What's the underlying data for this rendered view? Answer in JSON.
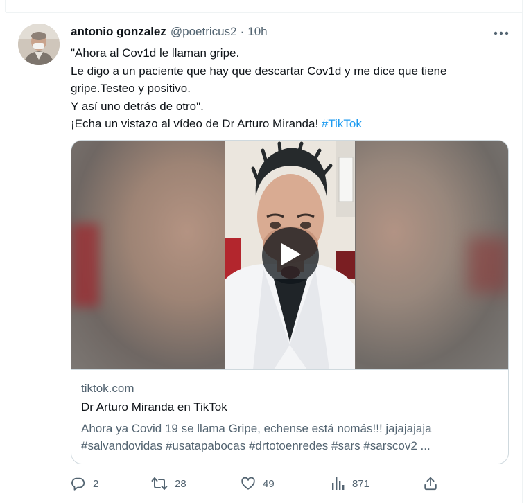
{
  "tweet": {
    "author_name": "antonio gonzalez",
    "author_handle": "@poetricus2",
    "separator": "·",
    "time_ago": "10h",
    "text_lines": [
      "\"Ahora al Cov1d le llaman gripe.",
      "Le digo a un paciente que hay que descartar Cov1d y me dice que tiene",
      "gripe.Testeo y positivo.",
      "Y así uno detrás de otro\".",
      "¡Echa un vistazo al vídeo de Dr Arturo Miranda! "
    ],
    "hashtag": "#TikTok"
  },
  "link_card": {
    "domain": "tiktok.com",
    "title": "Dr Arturo Miranda en TikTok",
    "description_lines": [
      "Ahora ya Covid 19 se llama Gripe, echense está nomás!!! jajajajaja",
      "#salvandovidas #usatapabocas #drtotoenredes #sars #sarscov2 ..."
    ]
  },
  "actions": {
    "replies": "2",
    "retweets": "28",
    "likes": "49",
    "views": "871"
  },
  "icons": {
    "more": "more-horizontal-icon",
    "play": "play-icon",
    "reply": "reply-icon",
    "retweet": "retweet-icon",
    "like": "heart-icon",
    "views": "views-chart-icon",
    "share": "share-icon"
  },
  "colors": {
    "text": "#0f1419",
    "secondary": "#536471",
    "link": "#1d9bf0",
    "border": "#cfd9de"
  }
}
